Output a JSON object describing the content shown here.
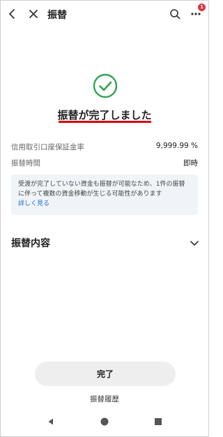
{
  "header": {
    "title": "振替",
    "badge_count": "1",
    "icons": [
      "chevron-left-icon",
      "close-icon",
      "search-icon",
      "more-icon"
    ]
  },
  "result": {
    "title": "振替が完了しました",
    "accent_color": "#2ea44f",
    "underline_color": "#d6000f"
  },
  "details": {
    "rows": [
      {
        "label": "信用取引口座保証金率",
        "value": "9,999.99 %"
      },
      {
        "label": "振替時間",
        "value": "即時"
      }
    ]
  },
  "notice": {
    "text": "受渡が完了していない資金も振替が可能なため、1件の振替に伴って複数の資金移動が生じる可能性があります",
    "link": "詳しく見る",
    "link_color": "#1d6fd0"
  },
  "section": {
    "title": "振替内容"
  },
  "actions": {
    "complete_label": "完了",
    "history_label": "振替履歴"
  },
  "navbar": {
    "icons": [
      "back-triangle-icon",
      "home-circle-icon",
      "recents-square-icon"
    ]
  }
}
